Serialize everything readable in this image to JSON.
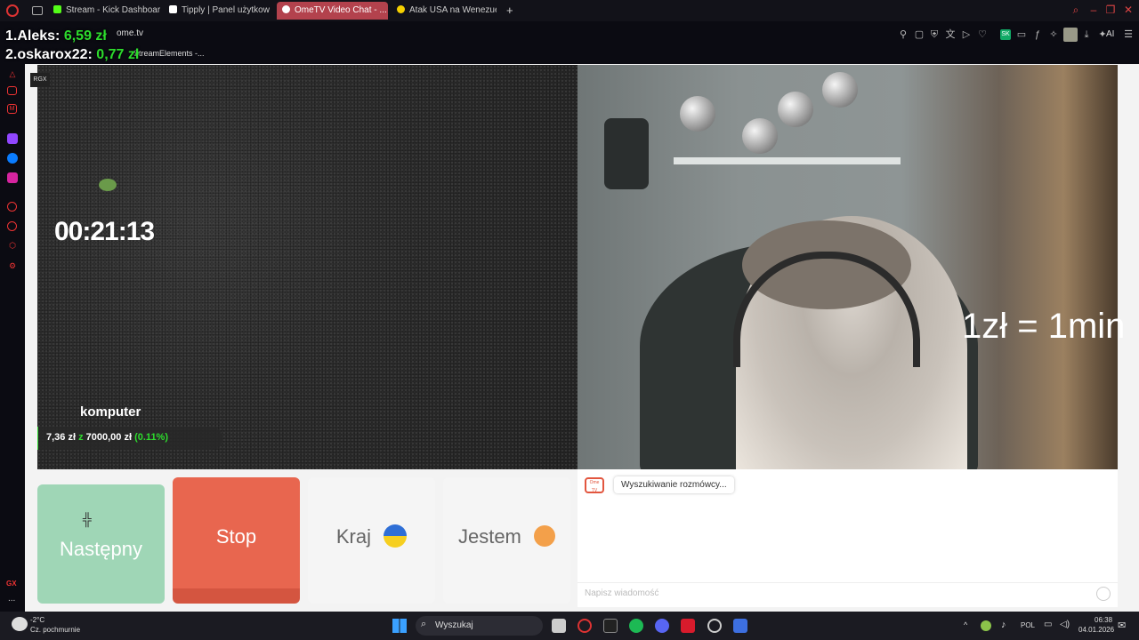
{
  "tabs": [
    {
      "label": "Stream - Kick Dashboard",
      "favicon_color": "#53fc18"
    },
    {
      "label": "Tipply | Panel użytkownika",
      "favicon_color": "#ffffff"
    },
    {
      "label": "OmeTV Video Chat - ...",
      "favicon_color": "#ffffff",
      "active": true
    },
    {
      "label": "Atak USA na Wenezuelę. T",
      "favicon_color": "#f5d000"
    }
  ],
  "new_tab": "+",
  "address": {
    "url": "ome.tv",
    "bookmark_label": "StreamElements -..."
  },
  "toolbar": {
    "ai_label": "AI"
  },
  "overlay": {
    "leaderboard": [
      {
        "rank_name": "1.Aleks:",
        "amount": "6,59 zł"
      },
      {
        "rank_name": "2.oskarox22:",
        "amount": "0,77 zł"
      }
    ],
    "rgx_label": "RGX",
    "timer": "00:21:13",
    "rate": "1zł = 1min",
    "goal_name": "komputer",
    "goal_current": "7,36 zł",
    "goal_sep": "z",
    "goal_target": "7000,00 zł",
    "goal_percent": "(0.11%)",
    "goal_fraction": 0.0011
  },
  "buttons": {
    "next": "Następny",
    "stop": "Stop",
    "country": "Kraj",
    "country_flag": "🇺🇦",
    "gender": "Jestem",
    "gender_emoji": "🧑"
  },
  "chat": {
    "logo": "Ome TV",
    "status": "Wyszukiwanie rozmówcy...",
    "input_placeholder": "Napisz wiadomość"
  },
  "sidebar_bottom": {
    "gx_label": "GX",
    "more": "..."
  },
  "taskbar": {
    "weather_temp": "-2°C",
    "weather_desc": "Cz. pochmurnie",
    "search_placeholder": "Wyszukaj",
    "lang": "POL",
    "time": "06:38",
    "date": "04.01.2026"
  },
  "colors": {
    "next_bg": "#9fd6b6",
    "stop_bg": "#e8664f",
    "tab_active": "#b3424d"
  }
}
